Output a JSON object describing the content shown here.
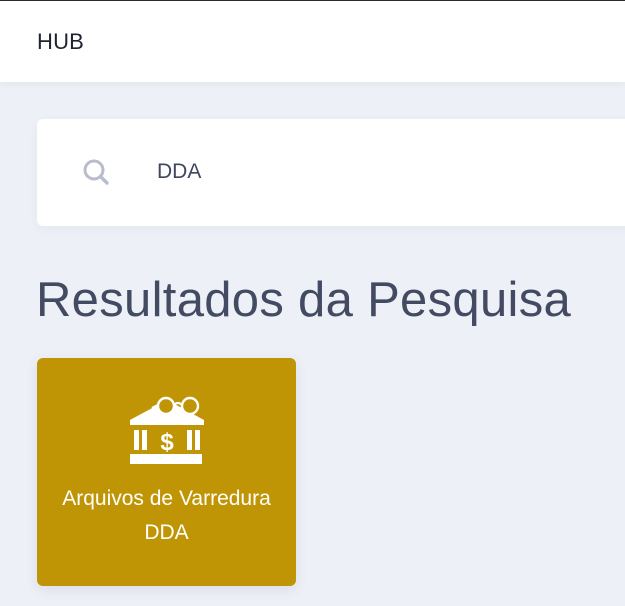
{
  "header": {
    "brand": "HUB"
  },
  "search": {
    "icon": "search-icon",
    "value": "DDA"
  },
  "results": {
    "title": "Resultados da Pesquisa",
    "items": [
      {
        "icon": "bank-glasses-icon",
        "label": "Arquivos de Varredura DDA",
        "color": "#c09505"
      }
    ]
  }
}
